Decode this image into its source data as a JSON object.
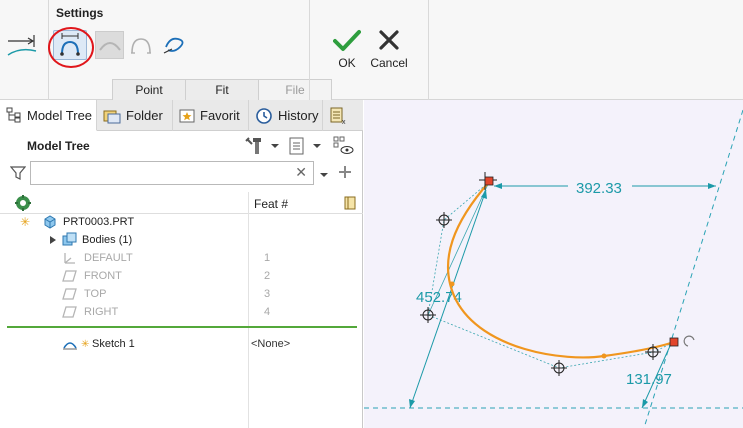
{
  "ribbon": {
    "group_label": "Settings",
    "subtabs": [
      {
        "label": "Point",
        "enabled": true
      },
      {
        "label": "Fit",
        "enabled": true
      },
      {
        "label": "File",
        "enabled": false
      }
    ],
    "ok_label": "OK",
    "cancel_label": "Cancel"
  },
  "panel": {
    "tabs": [
      {
        "label": "Model Tree",
        "icon": "tree-structure-icon",
        "active": true
      },
      {
        "label": "Folder",
        "icon": "folder-icon",
        "active": false
      },
      {
        "label": "Favorit",
        "icon": "favorites-icon",
        "active": false
      },
      {
        "label": "History",
        "icon": "history-icon",
        "active": false
      }
    ],
    "title": "Model Tree",
    "filter": {
      "value": "",
      "placeholder": ""
    },
    "column_header": "Feat #",
    "rows": [
      {
        "label": "PRT0003.PRT",
        "feat": "",
        "icon": "part-icon",
        "dim": false
      },
      {
        "label": "Bodies (1)",
        "feat": "",
        "icon": "bodies-icon",
        "dim": false
      },
      {
        "label": "DEFAULT",
        "feat": "1",
        "icon": "csys-icon",
        "dim": true
      },
      {
        "label": "FRONT",
        "feat": "2",
        "icon": "datum-plane-icon",
        "dim": true
      },
      {
        "label": "TOP",
        "feat": "3",
        "icon": "datum-plane-icon",
        "dim": true
      },
      {
        "label": "RIGHT",
        "feat": "4",
        "icon": "datum-plane-icon",
        "dim": true
      },
      {
        "label": "Sketch 1",
        "feat": "<None>",
        "icon": "sketch-icon",
        "dim": false
      }
    ]
  },
  "graphics": {
    "dimensions": [
      "392.33",
      "452.74",
      "131.97"
    ]
  },
  "colors": {
    "accent": "#1c9aa8",
    "curve": "#f0961e",
    "highlight": "#e0161b",
    "insert_line": "#53a83a"
  }
}
